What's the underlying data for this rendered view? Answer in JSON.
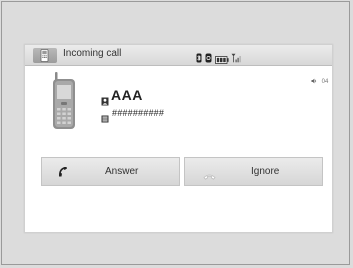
{
  "header": {
    "title": "Incoming call",
    "left_icon": "phone-icon",
    "status_icons": [
      "bluetooth-icon",
      "phone-link-icon",
      "battery-icon",
      "signal-icon"
    ]
  },
  "volume_indicator": {
    "icon": "speaker-icon",
    "text": "04"
  },
  "caller": {
    "name": "AAA",
    "number": "##########",
    "name_icon": "contact-icon",
    "number_icon": "phonebook-icon",
    "image_icon": "mobile-phone-icon"
  },
  "actions": {
    "answer_label": "Answer",
    "ignore_label": "Ignore",
    "answer_icon": "handset-icon",
    "ignore_icon": "handset-hangup-icon"
  },
  "colors": {
    "screen_bg": "#ffffff",
    "header_bg": "#e2e2e2",
    "button_bg": "#e0e0e0",
    "text": "#333333",
    "outer_bg": "#dcdcdc"
  }
}
